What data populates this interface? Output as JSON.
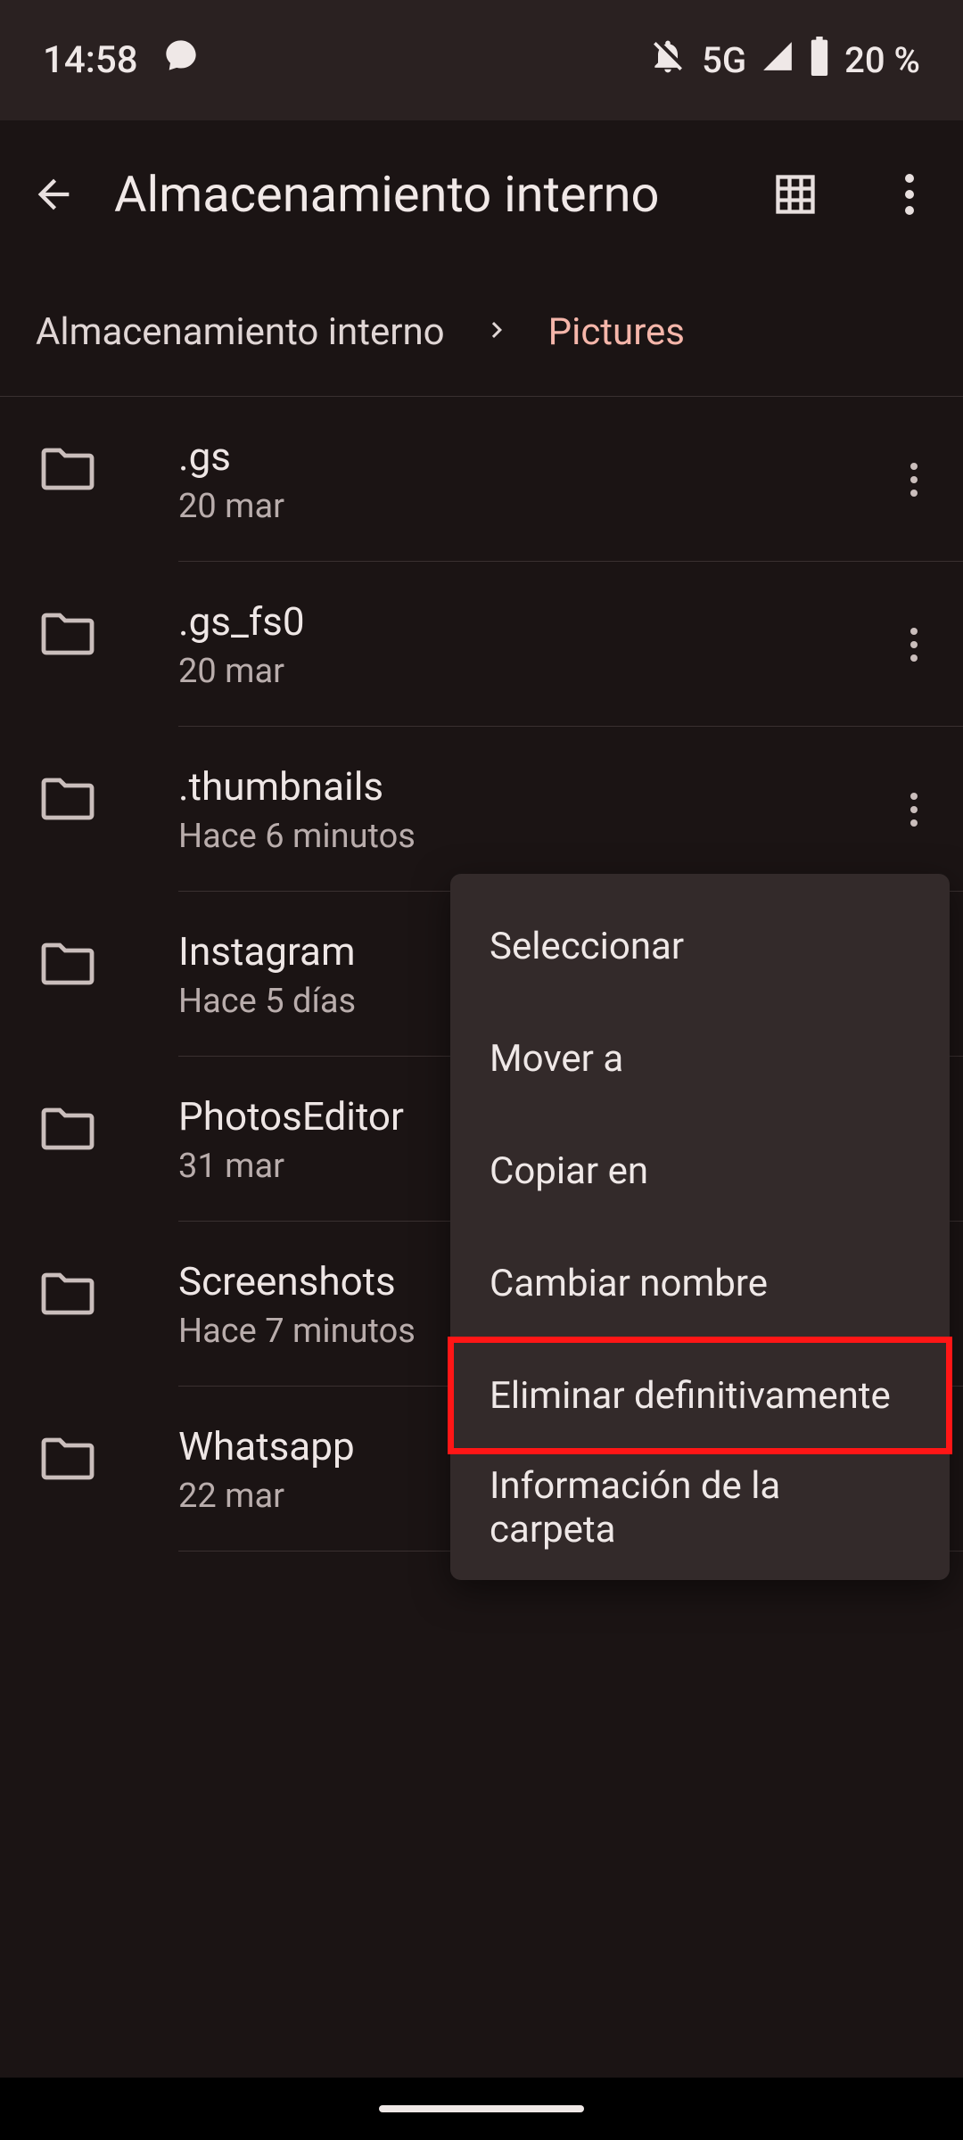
{
  "status": {
    "time": "14:58",
    "network": "5G",
    "battery": "20 %"
  },
  "app_bar": {
    "title": "Almacenamiento interno"
  },
  "breadcrumb": {
    "root": "Almacenamiento interno",
    "current": "Pictures"
  },
  "files": [
    {
      "name": ".gs",
      "date": "20 mar"
    },
    {
      "name": ".gs_fs0",
      "date": "20 mar"
    },
    {
      "name": ".thumbnails",
      "date": "Hace 6 minutos"
    },
    {
      "name": "Instagram",
      "date": "Hace 5 días"
    },
    {
      "name": "PhotosEditor",
      "date": "31 mar"
    },
    {
      "name": "Screenshots",
      "date": "Hace 7 minutos"
    },
    {
      "name": "Whatsapp",
      "date": "22 mar"
    }
  ],
  "menu": {
    "select": "Seleccionar",
    "move": "Mover a",
    "copy": "Copiar en",
    "rename": "Cambiar nombre",
    "delete": "Eliminar definitivamente",
    "info": "Información de la carpeta"
  },
  "colors": {
    "accent": "#f5b6aa",
    "highlight_box": "#ff1616"
  }
}
